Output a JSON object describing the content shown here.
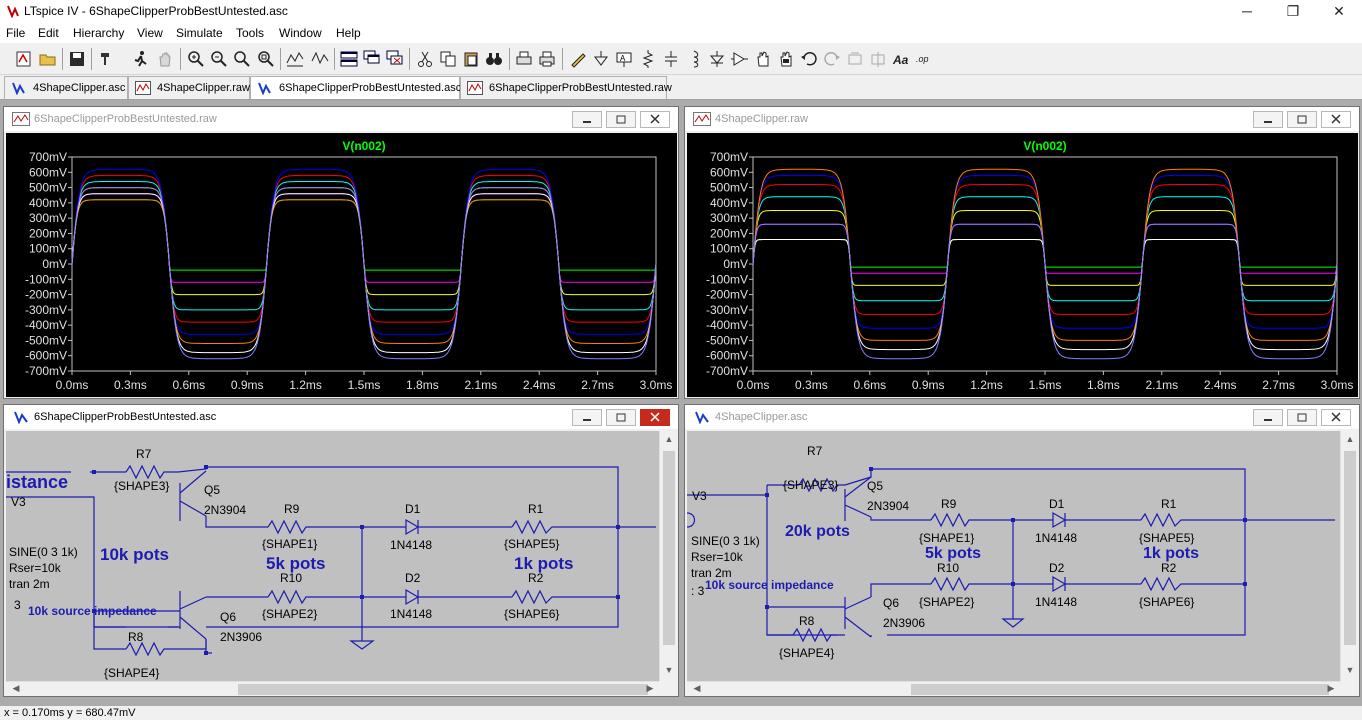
{
  "app": {
    "title": "LTspice IV - 6ShapeClipperProbBestUntested.asc",
    "minimize_glyph": "─",
    "maximize_glyph": "❐",
    "close_glyph": "✕"
  },
  "menu": [
    "File",
    "Edit",
    "Hierarchy",
    "View",
    "Simulate",
    "Tools",
    "Window",
    "Help"
  ],
  "toolbar_icons": [
    "new-schematic-icon",
    "open-folder-icon",
    "save-icon",
    "control-panel-icon",
    "run-icon",
    "halt-icon",
    "zoom-in-icon",
    "zoom-out-icon",
    "zoom-out-2-icon",
    "zoom-fit-icon",
    "autorange-icon",
    "tile-vertical-icon",
    "cascade-icon",
    "close-windows-icon",
    "cut-icon",
    "copy-icon",
    "find-icon",
    "print-preview-icon",
    "print-icon",
    "draw-wire-icon",
    "ground-icon",
    "label-net-icon",
    "resistor-icon",
    "capacitor-icon",
    "inductor-icon",
    "diode-icon",
    "component-icon",
    "move-icon",
    "drag-icon",
    "undo-icon",
    "redo-icon",
    "rotate-icon",
    "mirror-icon",
    "text-icon",
    "spice-directive-icon"
  ],
  "tabs": [
    {
      "label": "4ShapeClipper.asc",
      "kind": "schematic"
    },
    {
      "label": "4ShapeClipper.raw",
      "kind": "waveform"
    },
    {
      "label": "6ShapeClipperProbBestUntested.asc",
      "kind": "schematic",
      "active": true
    },
    {
      "label": "6ShapeClipperProbBestUntested.raw",
      "kind": "waveform"
    }
  ],
  "windows": {
    "wave_left": {
      "title": "6ShapeClipperProbBestUntested.raw"
    },
    "wave_right": {
      "title": "4ShapeClipper.raw"
    },
    "sch_left": {
      "title": "6ShapeClipperProbBestUntested.asc"
    },
    "sch_right": {
      "title": "4ShapeClipper.asc"
    }
  },
  "chart_data": [
    {
      "type": "line",
      "title": "V(n002)",
      "x_ticks": [
        "0.0ms",
        "0.3ms",
        "0.6ms",
        "0.9ms",
        "1.2ms",
        "1.5ms",
        "1.8ms",
        "2.1ms",
        "2.4ms",
        "2.7ms",
        "3.0ms"
      ],
      "y_ticks": [
        "700mV",
        "600mV",
        "500mV",
        "400mV",
        "300mV",
        "200mV",
        "100mV",
        "0mV",
        "-100mV",
        "-200mV",
        "-300mV",
        "-400mV",
        "-500mV",
        "-600mV",
        "-700mV"
      ],
      "xlim": [
        0,
        3
      ],
      "ylim": [
        -700,
        700
      ],
      "x_unit": "ms",
      "y_unit": "mV",
      "grid": false,
      "background": "#000000",
      "frequency_khz": 1,
      "pos_peak_mv": [
        420,
        460,
        500,
        540,
        580,
        620
      ],
      "neg_peak_mv": [
        -40,
        -120,
        -200,
        -300,
        -380,
        -460,
        -520,
        -580,
        -620
      ],
      "colors": [
        "#00ff00",
        "#ff00ff",
        "#ffff00",
        "#00ffff",
        "#ff0000",
        "#0000ff",
        "#ff8000",
        "#ffffff",
        "#8080ff",
        "#80ff80",
        "#c08040"
      ]
    },
    {
      "type": "line",
      "title": "V(n002)",
      "x_ticks": [
        "0.0ms",
        "0.3ms",
        "0.6ms",
        "0.9ms",
        "1.2ms",
        "1.5ms",
        "1.8ms",
        "2.1ms",
        "2.4ms",
        "2.7ms",
        "3.0ms"
      ],
      "y_ticks": [
        "700mV",
        "600mV",
        "500mV",
        "400mV",
        "300mV",
        "200mV",
        "100mV",
        "0mV",
        "-100mV",
        "-200mV",
        "-300mV",
        "-400mV",
        "-500mV",
        "-600mV",
        "-700mV"
      ],
      "xlim": [
        0,
        3
      ],
      "ylim": [
        -700,
        700
      ],
      "x_unit": "ms",
      "y_unit": "mV",
      "grid": false,
      "background": "#000000",
      "frequency_khz": 1,
      "pos_peak_mv": [
        160,
        260,
        350,
        440,
        520,
        580,
        620
      ],
      "neg_peak_mv": [
        -20,
        -60,
        -140,
        -240,
        -330,
        -420,
        -500,
        -560,
        -620
      ],
      "colors": [
        "#00ff00",
        "#ff00ff",
        "#ffff00",
        "#00ffff",
        "#ff0000",
        "#0000ff",
        "#ff8000",
        "#ffffff",
        "#8080ff",
        "#80ff80",
        "#c08040"
      ]
    }
  ],
  "schematic_left": {
    "partial_title": "istance",
    "v_label": "V3",
    "src": "SINE(0 3 1k)",
    "rser": "Rser=10k",
    "tran": "tran 2m",
    "three": "3",
    "src_imp": "10k source impedance",
    "pots_10k": "10k pots",
    "pots_5k": "5k pots",
    "pots_1k": "1k pots",
    "R7": "R7",
    "R7v": "{SHAPE3}",
    "Q5": "Q5",
    "Q5v": "2N3904",
    "R9": "R9",
    "R9v": "{SHAPE1}",
    "D1": "D1",
    "D1v": "1N4148",
    "R1": "R1",
    "R1v": "{SHAPE5}",
    "R10": "R10",
    "R10v": "{SHAPE2}",
    "D2": "D2",
    "D2v": "1N4148",
    "R2": "R2",
    "R2v": "{SHAPE6}",
    "Q6": "Q6",
    "Q6v": "2N3906",
    "R8": "R8",
    "R8v": "{SHAPE4}"
  },
  "schematic_right": {
    "v_label": "V3",
    "src": "SINE(0 3 1k)",
    "rser": "Rser=10k",
    "tran": "tran 2m",
    "three": ": 3",
    "src_imp": "10k source impedance",
    "pots_20k": "20k pots",
    "pots_5k": "5k pots",
    "pots_1k": "1k pots",
    "R7": "R7",
    "R7v": "{SHAPE3}",
    "Q5": "Q5",
    "Q5v": "2N3904",
    "R9": "R9",
    "R9v": "{SHAPE1}",
    "D1": "D1",
    "D1v": "1N4148",
    "R1": "R1",
    "R1v": "{SHAPE5}",
    "R10": "R10",
    "R10v": "{SHAPE2}",
    "D2": "D2",
    "D2v": "1N4148",
    "R2": "R2",
    "R2v": "{SHAPE6}",
    "Q6": "Q6",
    "Q6v": "2N3906",
    "R8": "R8",
    "R8v": "{SHAPE4}"
  },
  "status": "x = 0.170ms    y = 680.47mV"
}
